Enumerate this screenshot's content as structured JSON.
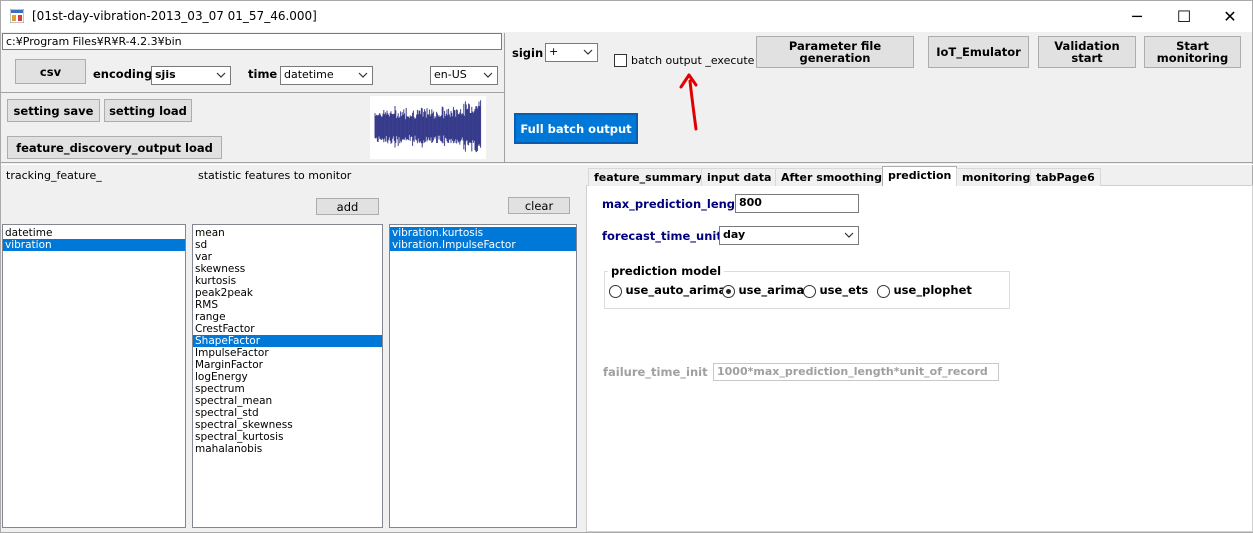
{
  "window": {
    "title": "[01st-day-vibration-2013_03_07 01_57_46.000]",
    "minimize": "─",
    "maximize": "☐",
    "close": "✕"
  },
  "path_field": {
    "value": "c:¥Program Files¥R¥R-4.2.3¥bin"
  },
  "toolbar": {
    "csv_label": "csv",
    "encoding_label": "encoding",
    "encoding_value": "sjis",
    "time_label": "time",
    "time_value": "datetime",
    "locale_value": "en-US",
    "setting_save_label": "setting save",
    "setting_load_label": "setting load",
    "feature_discovery_label": "feature_discovery_output load"
  },
  "top_right": {
    "sigin_label": "sigin",
    "sigin_value": "+",
    "batch_output_execute_label": "batch output _execute",
    "batch_output_execute_checked": false,
    "parameter_file_label": "Parameter file generation",
    "iot_emulator_label": "IoT_Emulator",
    "validation_start_label": "Validation start",
    "start_monitoring_label": "Start monitoring",
    "full_batch_output_label": "Full batch output"
  },
  "colors": {
    "accent": "#0078d7",
    "annotation_arrow": "#e00000",
    "waveform": "#1a1f7a",
    "label_navy": "#000080"
  },
  "left_panel": {
    "tracking_feature_label": "tracking_feature_",
    "statistic_features_label": "statistic features to monitor",
    "add_label": "add",
    "clear_label": "clear",
    "tracking_features": [
      {
        "label": "datetime",
        "selected": false
      },
      {
        "label": "vibration",
        "selected": true
      }
    ],
    "statistic_features": [
      {
        "label": "mean",
        "selected": false
      },
      {
        "label": "sd",
        "selected": false
      },
      {
        "label": "var",
        "selected": false
      },
      {
        "label": "skewness",
        "selected": false
      },
      {
        "label": "kurtosis",
        "selected": false
      },
      {
        "label": "peak2peak",
        "selected": false
      },
      {
        "label": "RMS",
        "selected": false
      },
      {
        "label": "range",
        "selected": false
      },
      {
        "label": "CrestFactor",
        "selected": false
      },
      {
        "label": "ShapeFactor",
        "selected": true
      },
      {
        "label": "ImpulseFactor",
        "selected": false
      },
      {
        "label": "MarginFactor",
        "selected": false
      },
      {
        "label": "logEnergy",
        "selected": false
      },
      {
        "label": "spectrum",
        "selected": false
      },
      {
        "label": "spectral_mean",
        "selected": false
      },
      {
        "label": "spectral_std",
        "selected": false
      },
      {
        "label": "spectral_skewness",
        "selected": false
      },
      {
        "label": "spectral_kurtosis",
        "selected": false
      },
      {
        "label": "mahalanobis",
        "selected": false
      }
    ],
    "monitored_features": [
      {
        "label": "vibration.kurtosis",
        "selected": true
      },
      {
        "label": "vibration.ImpulseFactor",
        "selected": true
      }
    ]
  },
  "tabs": [
    {
      "label": "feature_summary",
      "active": false
    },
    {
      "label": "input data",
      "active": false
    },
    {
      "label": "After smoothing",
      "active": false
    },
    {
      "label": "prediction",
      "active": true
    },
    {
      "label": "monitoring",
      "active": false
    },
    {
      "label": "tabPage6",
      "active": false
    }
  ],
  "prediction": {
    "max_prediction_length_label": "max_prediction_length",
    "max_prediction_length_value": "800",
    "forecast_time_unit_label": "forecast_time_unit",
    "forecast_time_unit_value": "day",
    "model_group_label": "prediction model",
    "models": [
      {
        "label": "use_auto_arima",
        "checked": false
      },
      {
        "label": "use_arima",
        "checked": true
      },
      {
        "label": "use_ets",
        "checked": false
      },
      {
        "label": "use_plophet",
        "checked": false
      }
    ],
    "failure_time_init_label": "failure_time_init",
    "failure_time_init_value": "1000*max_prediction_length*unit_of_record"
  }
}
